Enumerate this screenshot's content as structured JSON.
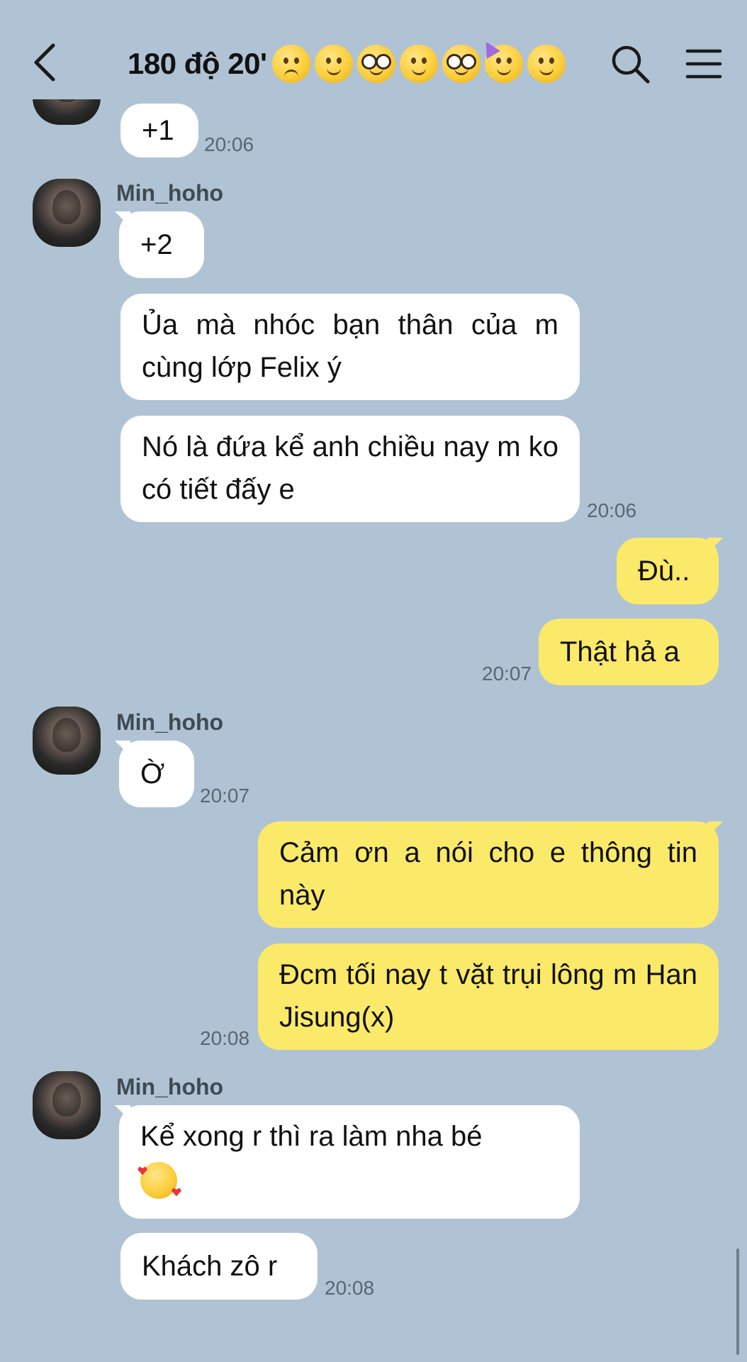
{
  "header": {
    "title": "180 độ 20'",
    "emojis": [
      "pensive-face",
      "slightly-smiling-face",
      "disguised-face",
      "slightly-smiling-face",
      "disguised-face",
      "partying-face",
      "slightly-smiling-face"
    ],
    "icons": [
      "back-chevron-icon",
      "search-icon",
      "menu-icon"
    ]
  },
  "messages": [
    {
      "side": "in",
      "text": "+1",
      "time": "20:06"
    },
    {
      "side": "in",
      "sender": "Min_hoho",
      "text": "+2"
    },
    {
      "side": "in",
      "text": "Ủa mà nhóc bạn thân của m cùng lớp Felix ý"
    },
    {
      "side": "in",
      "text": "Nó là đứa kể anh chiều nay m ko có tiết đấy e",
      "time": "20:06"
    },
    {
      "side": "out",
      "text": "Đù.."
    },
    {
      "side": "out",
      "text": "Thật hả a",
      "time": "20:07"
    },
    {
      "side": "in",
      "sender": "Min_hoho",
      "text": "Ờ",
      "time": "20:07"
    },
    {
      "side": "out",
      "text": "Cảm ơn a nói cho e thông tin này"
    },
    {
      "side": "out",
      "text": "Đcm tối nay t vặt trụi lông m Han Jisung(x)",
      "time": "20:08"
    },
    {
      "side": "in",
      "sender": "Min_hoho",
      "text": "Kể xong r thì ra làm nha bé",
      "emoji": "smiling-face-with-hearts"
    },
    {
      "side": "in",
      "text": "Khách zô r",
      "time": "20:08"
    }
  ],
  "colors": {
    "background": "#b0c3d4",
    "incoming_bubble": "#ffffff",
    "outgoing_bubble": "#fbe969"
  }
}
